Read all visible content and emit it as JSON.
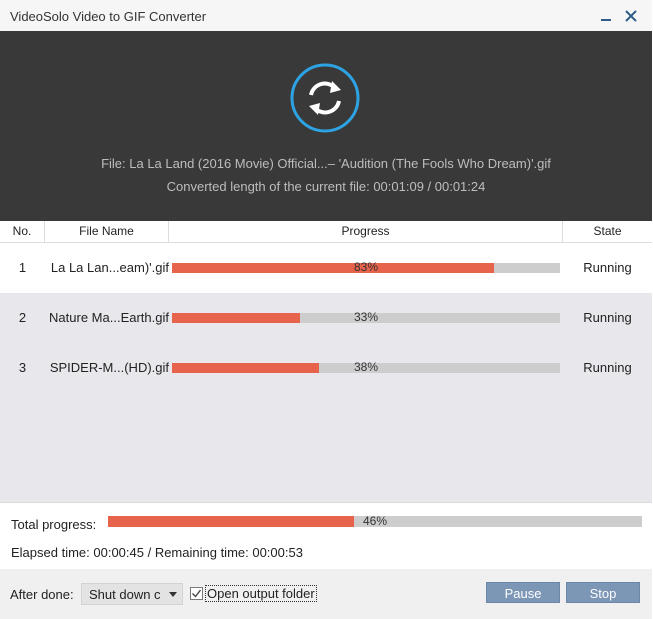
{
  "window": {
    "title": "VideoSolo Video to GIF Converter",
    "controls": {
      "minimize_icon": "minimize-icon",
      "close_icon": "close-icon"
    }
  },
  "header": {
    "icon": "convert-refresh-icon",
    "accent_color": "#2ea3e3",
    "file_text": "File: La La Land (2016 Movie) Official...– 'Audition (The Fools Who Dream)'.gif",
    "converted_text": "Converted length of the current file: 00:01:09 / 00:01:24"
  },
  "table": {
    "columns": [
      "No.",
      "File Name",
      "Progress",
      "State"
    ],
    "rows": [
      {
        "no": "1",
        "name": "La La Lan...eam)'.gif",
        "progress": 83,
        "progress_label": "83%",
        "state": "Running"
      },
      {
        "no": "2",
        "name": "Nature Ma...Earth.gif",
        "progress": 33,
        "progress_label": "33%",
        "state": "Running"
      },
      {
        "no": "3",
        "name": "SPIDER-M...(HD).gif",
        "progress": 38,
        "progress_label": "38%",
        "state": "Running"
      }
    ]
  },
  "summary": {
    "total_label": "Total progress:",
    "total_progress": 46,
    "total_progress_label": "46%",
    "time_text": "Elapsed time: 00:00:45 / Remaining time: 00:00:53"
  },
  "footer": {
    "after_done_label": "After done:",
    "after_done_value": "Shut down c",
    "open_output_label": "Open output folder",
    "open_output_checked": true,
    "pause_label": "Pause",
    "stop_label": "Stop"
  },
  "colors": {
    "progress_fill": "#e8634c",
    "progress_track": "#cdcdcd",
    "header_bg": "#393939",
    "button_bg": "#7c96b6"
  }
}
